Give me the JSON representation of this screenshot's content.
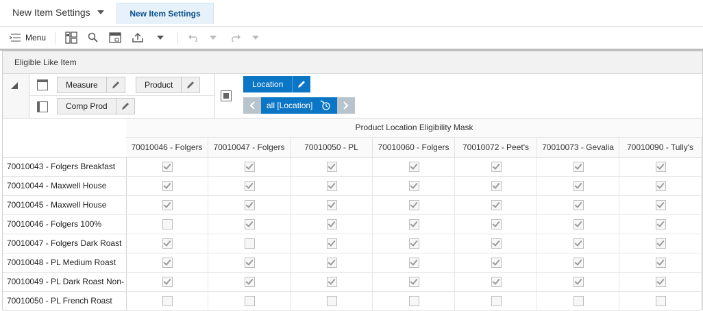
{
  "header": {
    "title_dropdown": "New Item Settings",
    "active_tab": "New Item Settings"
  },
  "toolbar": {
    "menu_label": "Menu"
  },
  "panel": {
    "title": "Eligible Like Item"
  },
  "pivot": {
    "measure_label": "Measure",
    "product_label": "Product",
    "comp_prod_label": "Comp Prod",
    "location_label": "Location",
    "location_nav_label": "all [Location]"
  },
  "grid": {
    "group_header": "Product Location Eligibility Mask",
    "columns": [
      "70010046 - Folgers",
      "70010047 - Folgers",
      "70010050 - PL",
      "70010060 - Folgers",
      "70010072 - Peet's",
      "70010073 - Gevalia",
      "70010090 - Tully's"
    ],
    "rows": [
      {
        "label": "70010043 - Folgers Breakfast",
        "checks": [
          true,
          true,
          true,
          true,
          true,
          true,
          true
        ]
      },
      {
        "label": "70010044 - Maxwell House",
        "checks": [
          true,
          true,
          true,
          true,
          true,
          true,
          true
        ]
      },
      {
        "label": "70010045 - Maxwell House",
        "checks": [
          true,
          true,
          true,
          true,
          true,
          true,
          true
        ]
      },
      {
        "label": "70010046 - Folgers 100%",
        "checks": [
          false,
          true,
          true,
          true,
          true,
          true,
          true
        ]
      },
      {
        "label": "70010047 - Folgers Dark Roast",
        "checks": [
          true,
          false,
          true,
          true,
          true,
          true,
          true
        ]
      },
      {
        "label": "70010048 - PL Medium Roast",
        "checks": [
          true,
          true,
          true,
          true,
          true,
          true,
          true
        ]
      },
      {
        "label": "70010049 - PL Dark Roast Non-",
        "checks": [
          true,
          true,
          true,
          true,
          true,
          true,
          true
        ]
      },
      {
        "label": "70010050 - PL French Roast",
        "checks": [
          false,
          false,
          false,
          false,
          false,
          false,
          false
        ]
      }
    ]
  },
  "colors": {
    "accent": "#0b76c5",
    "tab_bg": "#e6f1fa",
    "nav_arrow": "#b9c3cc"
  }
}
